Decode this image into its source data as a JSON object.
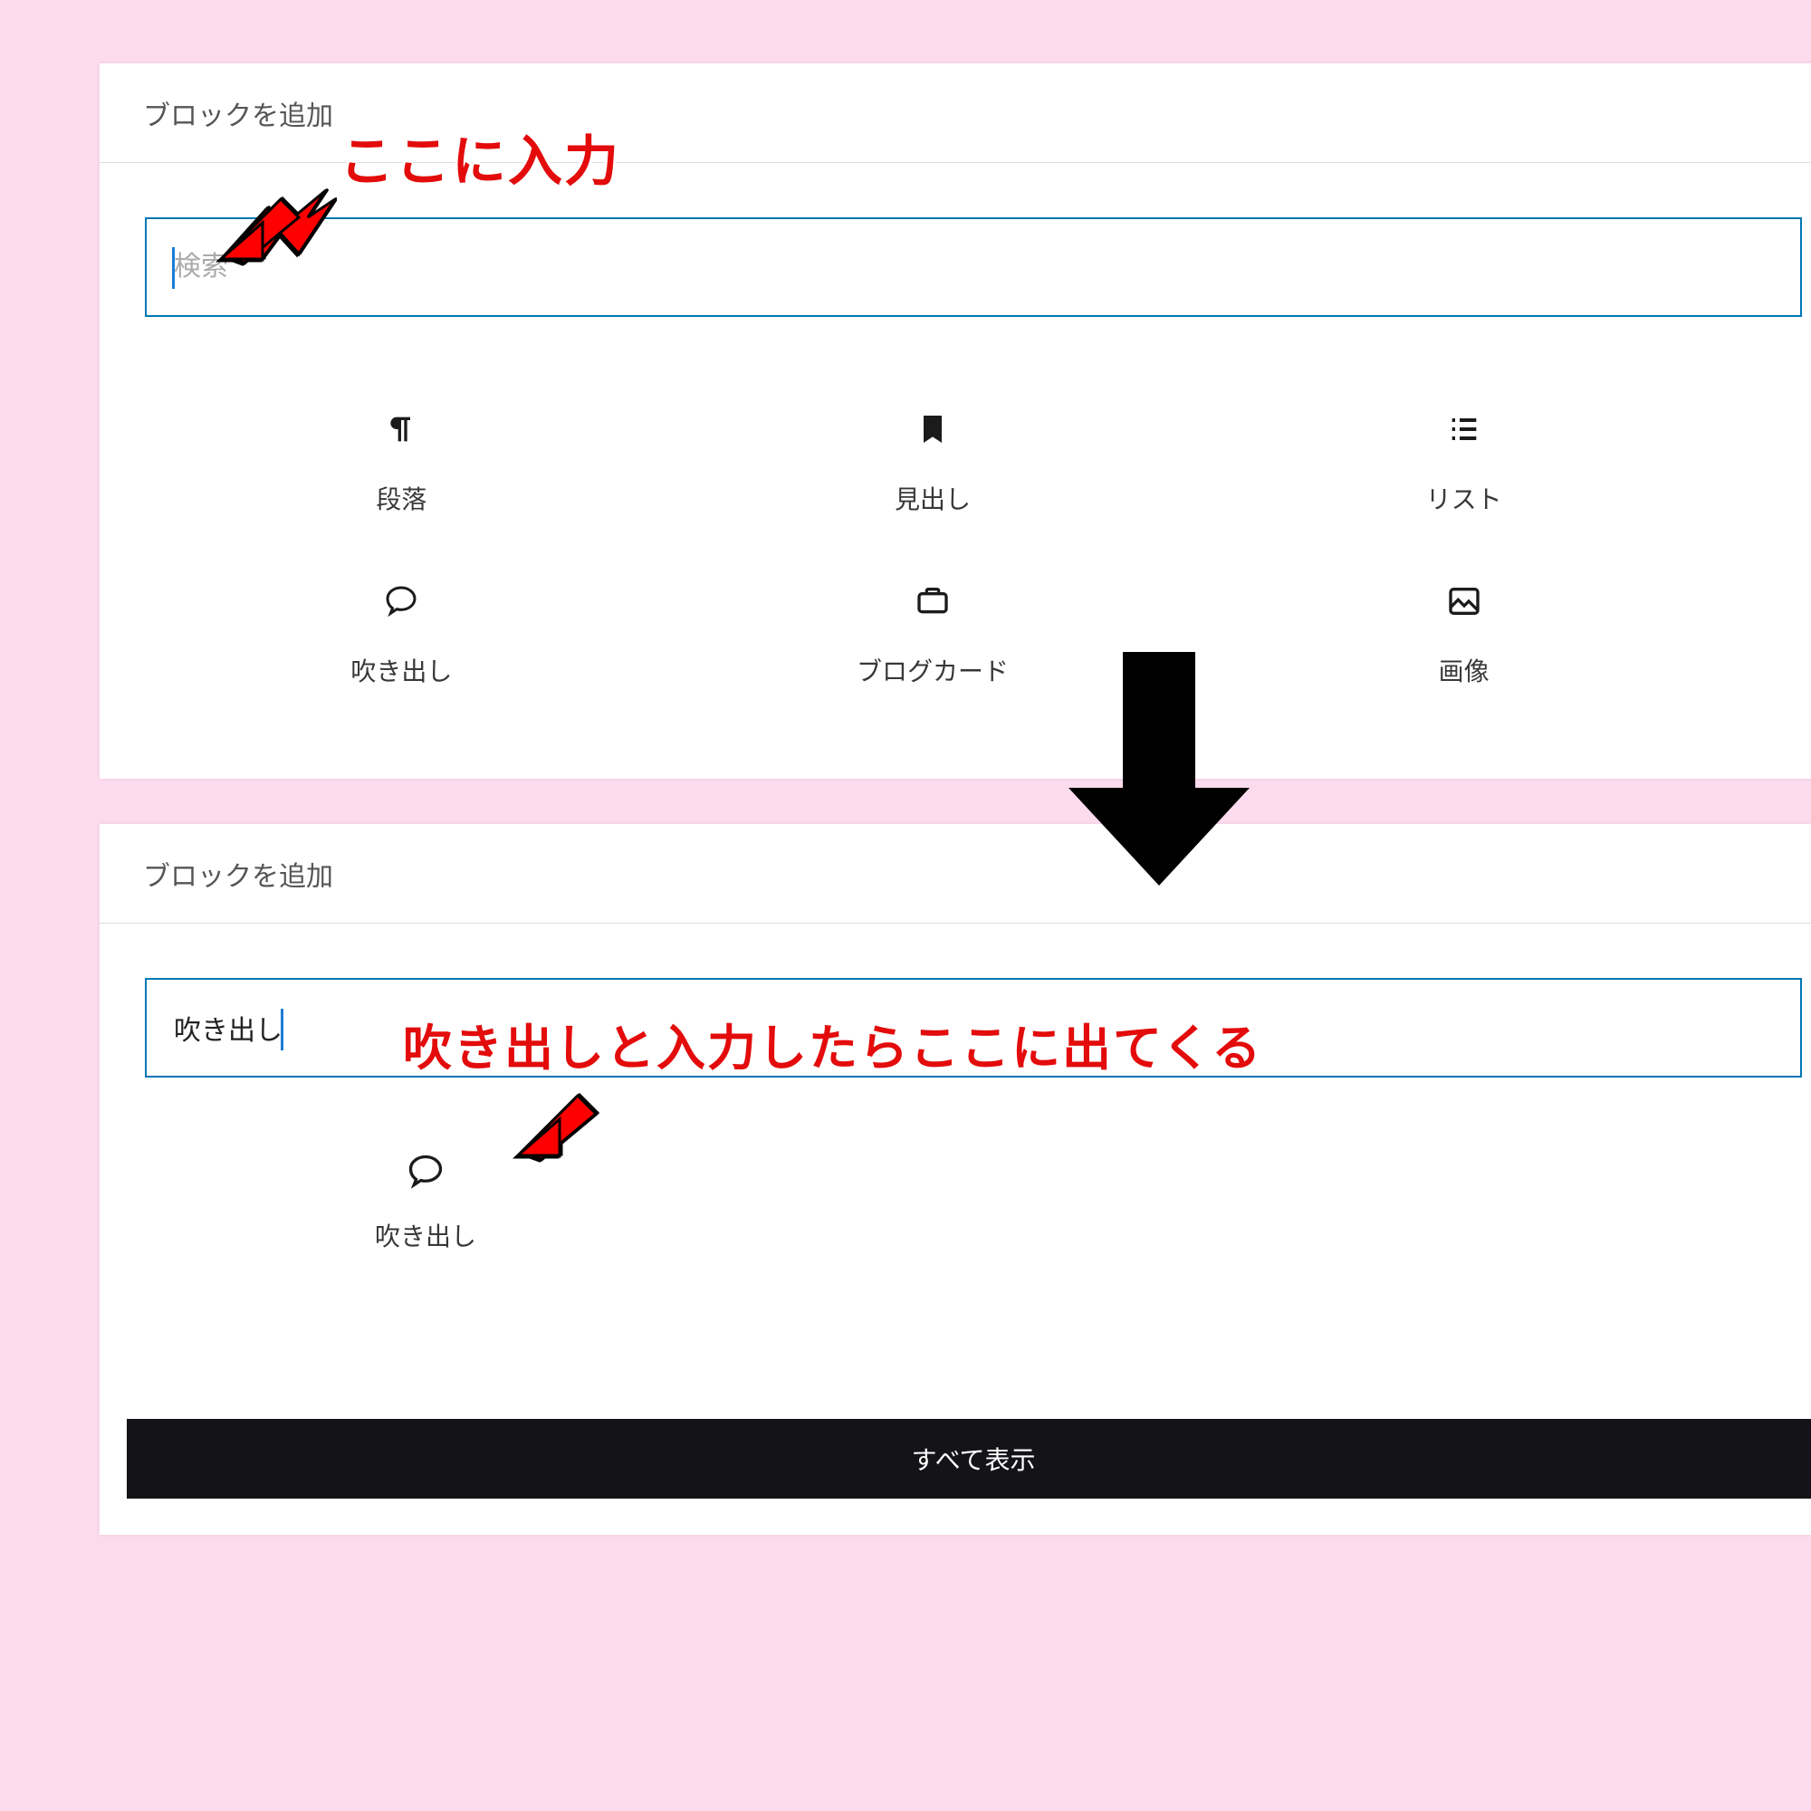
{
  "panel1": {
    "title": "ブロックを追加",
    "search_placeholder": "検索",
    "search_value": "",
    "blocks": [
      {
        "label": "段落"
      },
      {
        "label": "見出し"
      },
      {
        "label": "リスト"
      },
      {
        "label": "吹き出し"
      },
      {
        "label": "ブログカード"
      },
      {
        "label": "画像"
      }
    ]
  },
  "panel2": {
    "title": "ブロックを追加",
    "search_value": "吹き出し",
    "result_label": "吹き出し",
    "show_all": "すべて表示"
  },
  "annotations": {
    "a1": "ここに入力",
    "a2": "吹き出しと入力したらここに出てくる"
  }
}
